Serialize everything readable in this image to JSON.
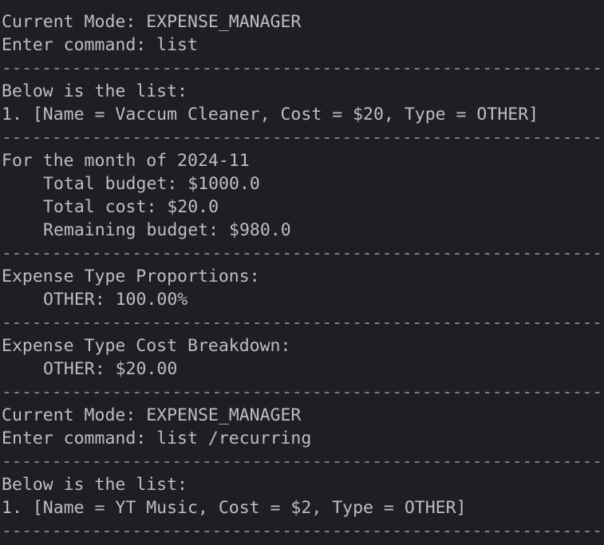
{
  "separator": "--------------------------------------------------------------",
  "lines": [
    {
      "kind": "separator"
    },
    {
      "kind": "text",
      "text": "Current Mode: EXPENSE_MANAGER"
    },
    {
      "kind": "text",
      "text": "Enter command: list"
    },
    {
      "kind": "separator"
    },
    {
      "kind": "text",
      "text": "Below is the list:"
    },
    {
      "kind": "text",
      "text": "1. [Name = Vaccum Cleaner, Cost = $20, Type = OTHER]"
    },
    {
      "kind": "separator"
    },
    {
      "kind": "text",
      "text": "For the month of 2024-11"
    },
    {
      "kind": "indented",
      "text": "Total budget: $1000.0"
    },
    {
      "kind": "indented",
      "text": "Total cost: $20.0"
    },
    {
      "kind": "indented",
      "text": "Remaining budget: $980.0"
    },
    {
      "kind": "separator"
    },
    {
      "kind": "text",
      "text": "Expense Type Proportions:"
    },
    {
      "kind": "indented",
      "text": "OTHER: 100.00%"
    },
    {
      "kind": "separator"
    },
    {
      "kind": "text",
      "text": "Expense Type Cost Breakdown:"
    },
    {
      "kind": "indented",
      "text": "OTHER: $20.00"
    },
    {
      "kind": "separator"
    },
    {
      "kind": "text",
      "text": "Current Mode: EXPENSE_MANAGER"
    },
    {
      "kind": "text",
      "text": "Enter command: list /recurring"
    },
    {
      "kind": "separator"
    },
    {
      "kind": "text",
      "text": "Below is the list:"
    },
    {
      "kind": "text",
      "text": "1. [Name = YT Music, Cost = $2, Type = OTHER]"
    },
    {
      "kind": "separator"
    }
  ]
}
